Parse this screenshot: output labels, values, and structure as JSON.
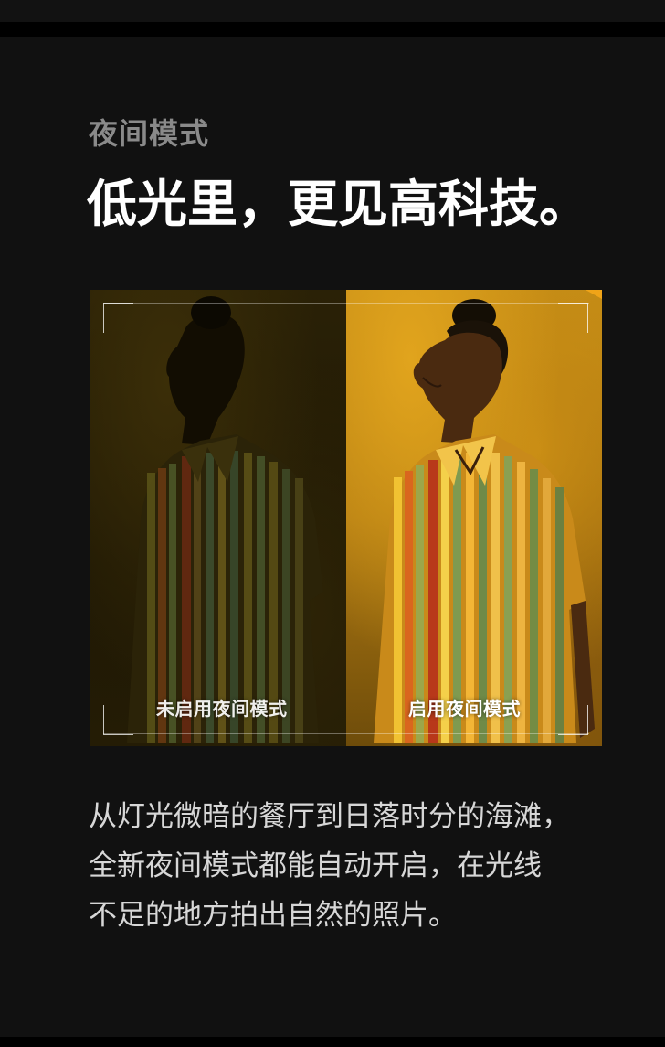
{
  "section": {
    "eyebrow": "夜间模式",
    "headline": "低光里，更见高科技。",
    "compare": {
      "left_caption": "未启用夜间模式",
      "right_caption": "启用夜间模式",
      "icon": "night-mode-moon-icon"
    },
    "body_lines": [
      "从灯光微暗的餐厅到日落时分的海滩，",
      "全新夜间模式都能自动开启，在光线",
      "不足的地方拍出自然的照片。"
    ]
  },
  "colors": {
    "background": "#111111",
    "eyebrow": "#8a8a8a",
    "headline": "#ffffff",
    "body": "#d7d7d7",
    "accent": "#f2c21b"
  }
}
